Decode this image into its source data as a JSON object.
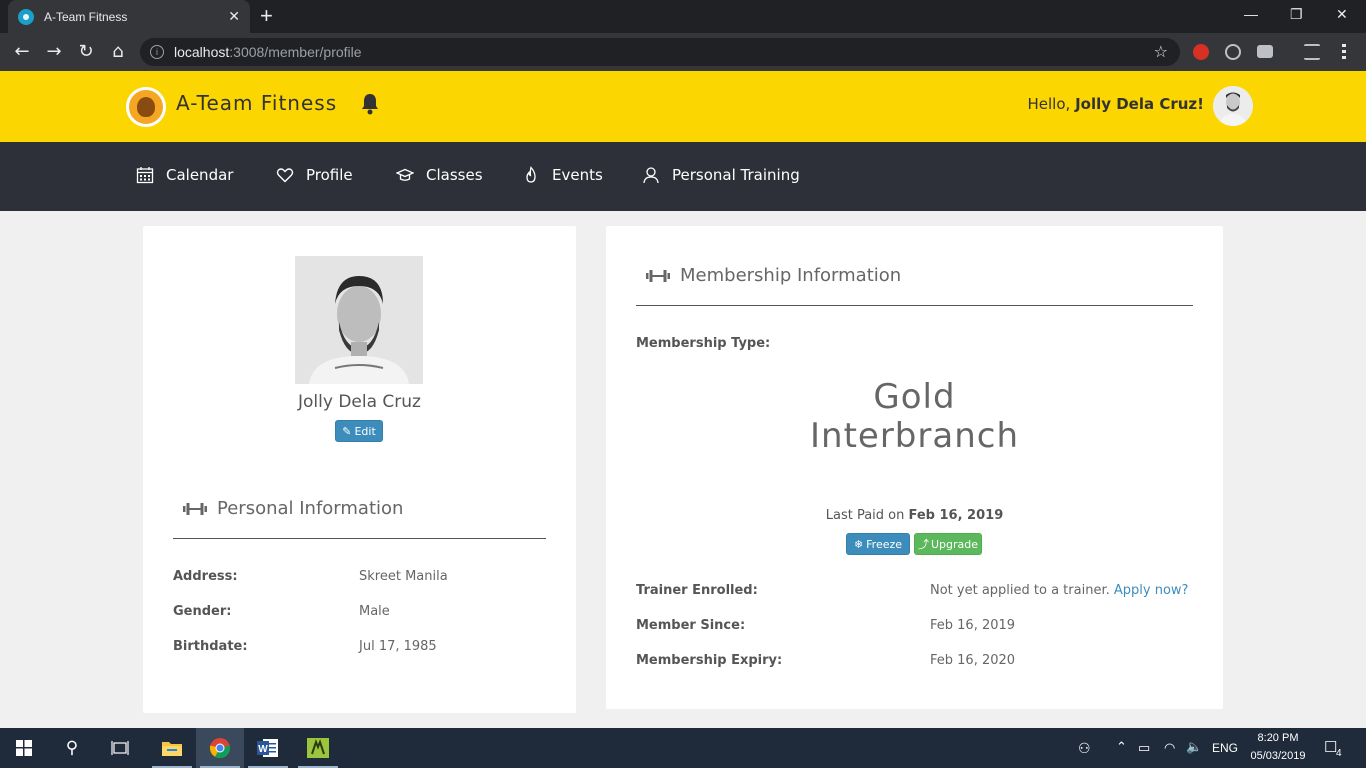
{
  "browser": {
    "tab_title": "A-Team Fitness",
    "tab_close": "✕",
    "new_tab": "+",
    "url_host": "localhost",
    "url_path": ":3008/member/profile",
    "info_glyph": "i"
  },
  "header": {
    "brand": "A-Team Fitness",
    "greeting_prefix": "Hello, ",
    "user_name": "Jolly Dela Cruz!",
    "accent_color": "#fcd600"
  },
  "nav": {
    "items": [
      {
        "label": "Calendar",
        "icon": "calendar-icon"
      },
      {
        "label": "Profile",
        "icon": "heart-icon"
      },
      {
        "label": "Classes",
        "icon": "graduation-cap-icon"
      },
      {
        "label": "Events",
        "icon": "fire-icon"
      },
      {
        "label": "Personal Training",
        "icon": "user-icon"
      }
    ]
  },
  "profile": {
    "name": "Jolly Dela Cruz",
    "edit_label": "Edit",
    "personal_title": "Personal Information",
    "fields": [
      {
        "label": "Address:",
        "value": "Skreet Manila"
      },
      {
        "label": "Gender:",
        "value": "Male"
      },
      {
        "label": "Birthdate:",
        "value": "Jul 17, 1985"
      }
    ]
  },
  "membership": {
    "title": "Membership Information",
    "type_label": "Membership Type:",
    "type_line1": "Gold",
    "type_line2": "Interbranch",
    "last_paid_prefix": "Last Paid on ",
    "last_paid_date": "Feb 16, 2019",
    "freeze_label": "Freeze",
    "upgrade_label": "Upgrade",
    "trainer_label": "Trainer Enrolled:",
    "trainer_value": "Not yet applied to a trainer. ",
    "apply_link": "Apply now?",
    "since_label": "Member Since:",
    "since_value": "Feb 16, 2019",
    "expiry_label": "Membership Expiry:",
    "expiry_value": "Feb 16, 2020"
  },
  "taskbar": {
    "lang": "ENG",
    "time": "8:20 PM",
    "date": "05/03/2019",
    "notif_count": "4"
  }
}
